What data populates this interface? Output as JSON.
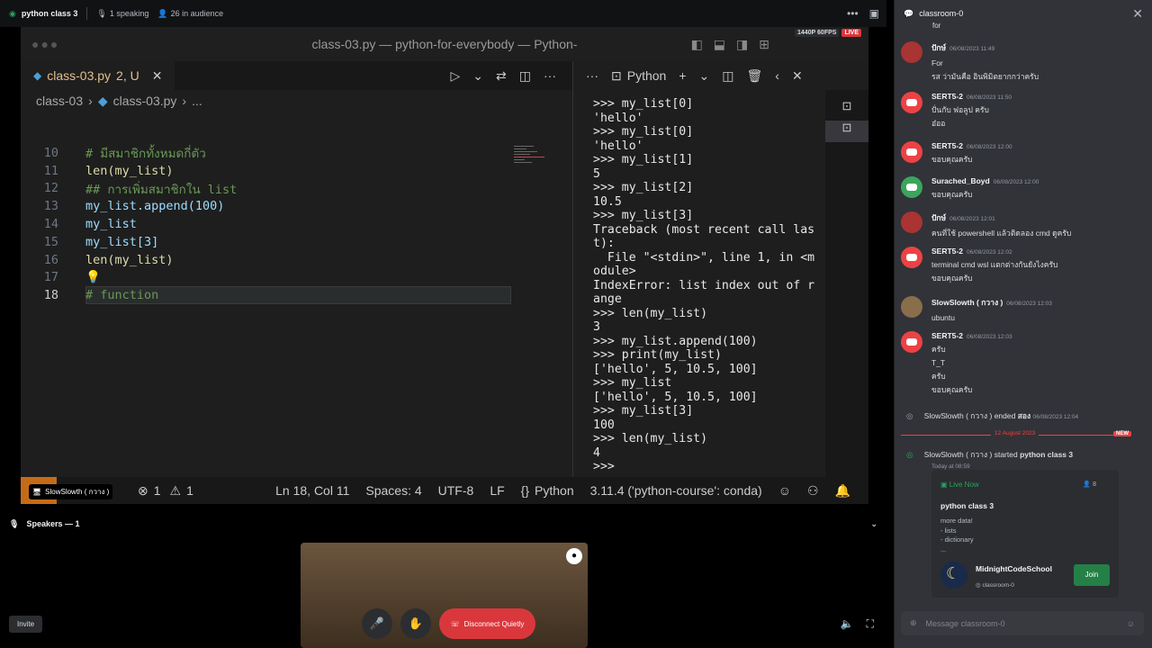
{
  "topbar": {
    "title": "python class 3",
    "speaking": "1 speaking",
    "audience": "26 in audience"
  },
  "vscode": {
    "window_title": "class-03.py — python-for-everybody — Python-",
    "stream_quality": "1440P 60FPS",
    "live": "LIVE",
    "tab": {
      "name": "class-03.py",
      "status": "2, U"
    },
    "breadcrumb": {
      "folder": "class-03",
      "file": "class-03.py",
      "more": "..."
    },
    "code_lines": [
      {
        "n": "10",
        "text": "# มีสมาชิกทั้งหมดกี่ตัว"
      },
      {
        "n": "11",
        "text": "len(my_list)"
      },
      {
        "n": "12",
        "text": "## การเพิ่มสมาชิกใน list"
      },
      {
        "n": "13",
        "text": "my_list.append(100)"
      },
      {
        "n": "14",
        "text": "my_list"
      },
      {
        "n": "15",
        "text": "my_list[3]"
      },
      {
        "n": "16",
        "text": "len(my_list)"
      },
      {
        "n": "17",
        "text": "💡"
      },
      {
        "n": "18",
        "text": "# function"
      }
    ],
    "terminal": {
      "label": "Python",
      "output": ">>> my_list[0]\n'hello'\n>>> my_list[0]\n'hello'\n>>> my_list[1]\n5\n>>> my_list[2]\n10.5\n>>> my_list[3]\nTraceback (most recent call las\nt):\n  File \"<stdin>\", line 1, in <m\nodule>\nIndexError: list index out of r\nange\n>>> len(my_list)\n3\n>>> my_list.append(100)\n>>> print(my_list)\n['hello', 5, 10.5, 100]\n>>> my_list\n['hello', 5, 10.5, 100]\n>>> my_list[3]\n100\n>>> len(my_list)\n4\n>>> "
    },
    "statusbar": {
      "errors": "1",
      "warnings": "1",
      "position": "Ln 18, Col 11",
      "spaces": "Spaces: 4",
      "encoding": "UTF-8",
      "eol": "LF",
      "language": "Python",
      "interpreter": "3.11.4 ('python-course': conda)"
    },
    "speaker_label": "SlowSlowth ( กวาง )"
  },
  "speakers": {
    "label": "Speakers — 1"
  },
  "controls": {
    "invite": "Invite",
    "disconnect": "Disconnect Quietly"
  },
  "chat": {
    "channel": "classroom-0",
    "top_partial": "for",
    "messages": [
      {
        "user": "ปักษ์",
        "time": "06/08/2023 11:49",
        "lines": [
          "For",
          "รส ว่ามันคือ อินพิมิตยากกว่าครับ"
        ],
        "avatar": "user"
      },
      {
        "user": "SERT5-2",
        "time": "06/08/2023 11:50",
        "lines": [
          "ปั่นกับ ฟอลูป ครับ",
          "อ๋ออ"
        ],
        "avatar": "discord"
      },
      {
        "user": "SERT5-2",
        "time": "06/08/2023 12:00",
        "lines": [
          "ขอบคุณครับ"
        ],
        "avatar": "discord"
      },
      {
        "user": "Surached_Boyd",
        "time": "06/08/2023 12:00",
        "lines": [
          "ขอบคุณครับ"
        ],
        "avatar": "discord-green"
      },
      {
        "user": "ปักษ์",
        "time": "06/08/2023 12:01",
        "lines": [
          "คนที่ใช้ powershell แล้วติดลอง cmd ดูครับ"
        ],
        "avatar": "user"
      },
      {
        "user": "SERT5-2",
        "time": "06/08/2023 12:02",
        "lines": [
          "terminal cmd wsl แตกต่างกันยังไงครับ",
          "ขอบคุณครับ"
        ],
        "avatar": "discord"
      },
      {
        "user": "SlowSlowth ( กวาง )",
        "time": "06/08/2023 12:03",
        "lines": [
          "ubuntu"
        ],
        "avatar": "sloth"
      },
      {
        "user": "SERT5-2",
        "time": "06/08/2023 12:03",
        "lines": [
          "ครับ",
          "T_T",
          "ครับ",
          "ขอบคุณครับ"
        ],
        "avatar": "discord"
      }
    ],
    "ended": {
      "user": "SlowSlowth ( กวาง )",
      "action": "ended",
      "event": "สอง",
      "time": "06/08/2023 12:04"
    },
    "date_divider": "12 August 2023",
    "new_label": "NEW",
    "started": {
      "user": "SlowSlowth ( กวาง )",
      "action": "started",
      "event": "python class 3",
      "time": "Today at 08:59"
    },
    "card": {
      "status": "Live Now",
      "count": "8",
      "title": "python class 3",
      "description": "more data!\n- lists\n- dictionary\n...",
      "server": "MidnightCodeSchool",
      "channel": "classroom-0",
      "join": "Join"
    },
    "input_placeholder": "Message classroom-0"
  }
}
